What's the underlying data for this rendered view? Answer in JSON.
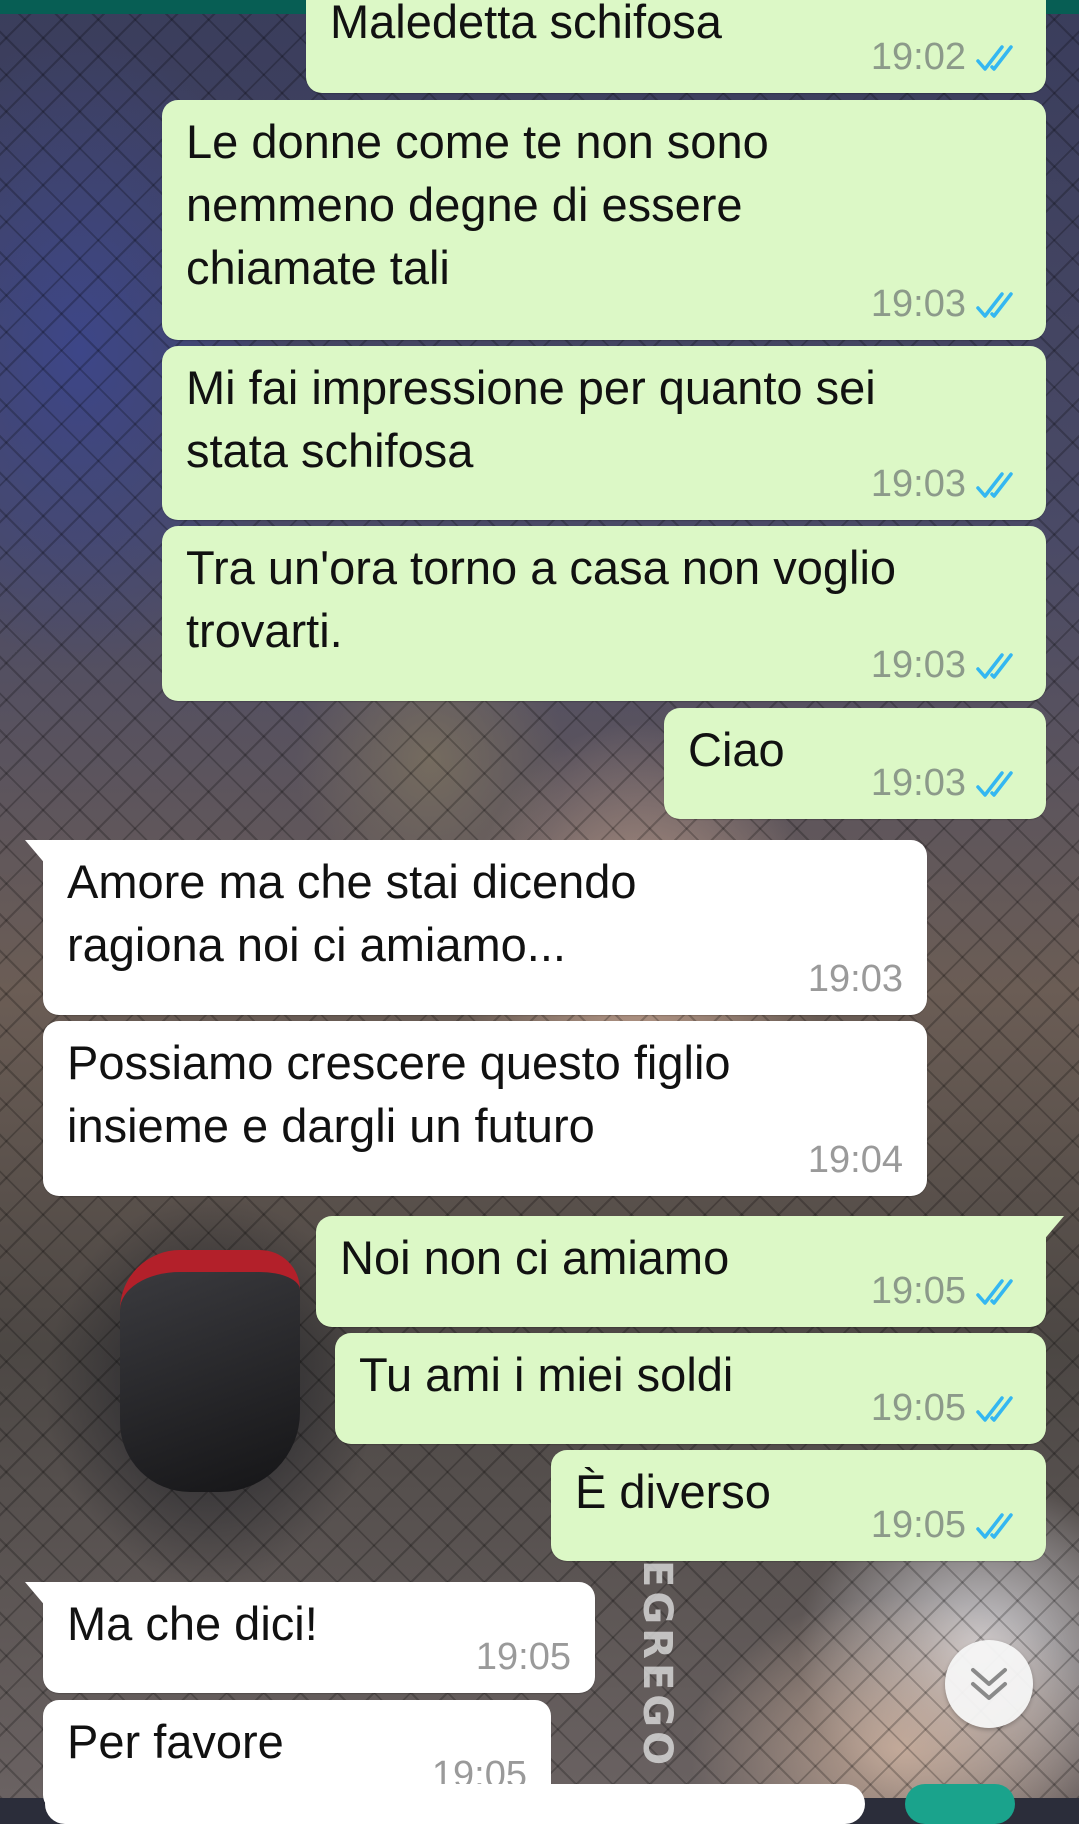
{
  "colors": {
    "outgoing_bubble": "#dcf8c6",
    "incoming_bubble": "#ffffff",
    "read_ticks": "#34b7f1",
    "header": "#075e54"
  },
  "wallpaper": {
    "shorts_text": "EGREGO"
  },
  "messages": [
    {
      "direction": "outgoing",
      "text": "Maledetta schifosa",
      "time": "19:02",
      "status": "read"
    },
    {
      "direction": "outgoing",
      "text": "Le donne come te non sono\nnemmeno degne di essere\nchiamate tali",
      "time": "19:03",
      "status": "read"
    },
    {
      "direction": "outgoing",
      "text": "Mi fai impressione per quanto sei\nstata schifosa",
      "time": "19:03",
      "status": "read"
    },
    {
      "direction": "outgoing",
      "text": "Tra un'ora torno a casa non voglio\ntrovarti.",
      "time": "19:03",
      "status": "read"
    },
    {
      "direction": "outgoing",
      "text": "Ciao",
      "time": "19:03",
      "status": "read"
    },
    {
      "direction": "incoming",
      "text": "Amore ma che stai dicendo\nragiona noi ci amiamo...",
      "time": "19:03"
    },
    {
      "direction": "incoming",
      "text": "Possiamo crescere questo figlio\ninsieme e dargli un futuro",
      "time": "19:04"
    },
    {
      "direction": "outgoing",
      "text": "Noi non ci amiamo",
      "time": "19:05",
      "status": "read"
    },
    {
      "direction": "outgoing",
      "text": "Tu ami i miei soldi",
      "time": "19:05",
      "status": "read"
    },
    {
      "direction": "outgoing",
      "text": "È diverso",
      "time": "19:05",
      "status": "read"
    },
    {
      "direction": "incoming",
      "text": "Ma che dici!",
      "time": "19:05"
    },
    {
      "direction": "incoming",
      "text": "Per favore",
      "time": "19:05"
    }
  ],
  "scroll_down": {
    "icon": "chevron-double-down-icon"
  }
}
